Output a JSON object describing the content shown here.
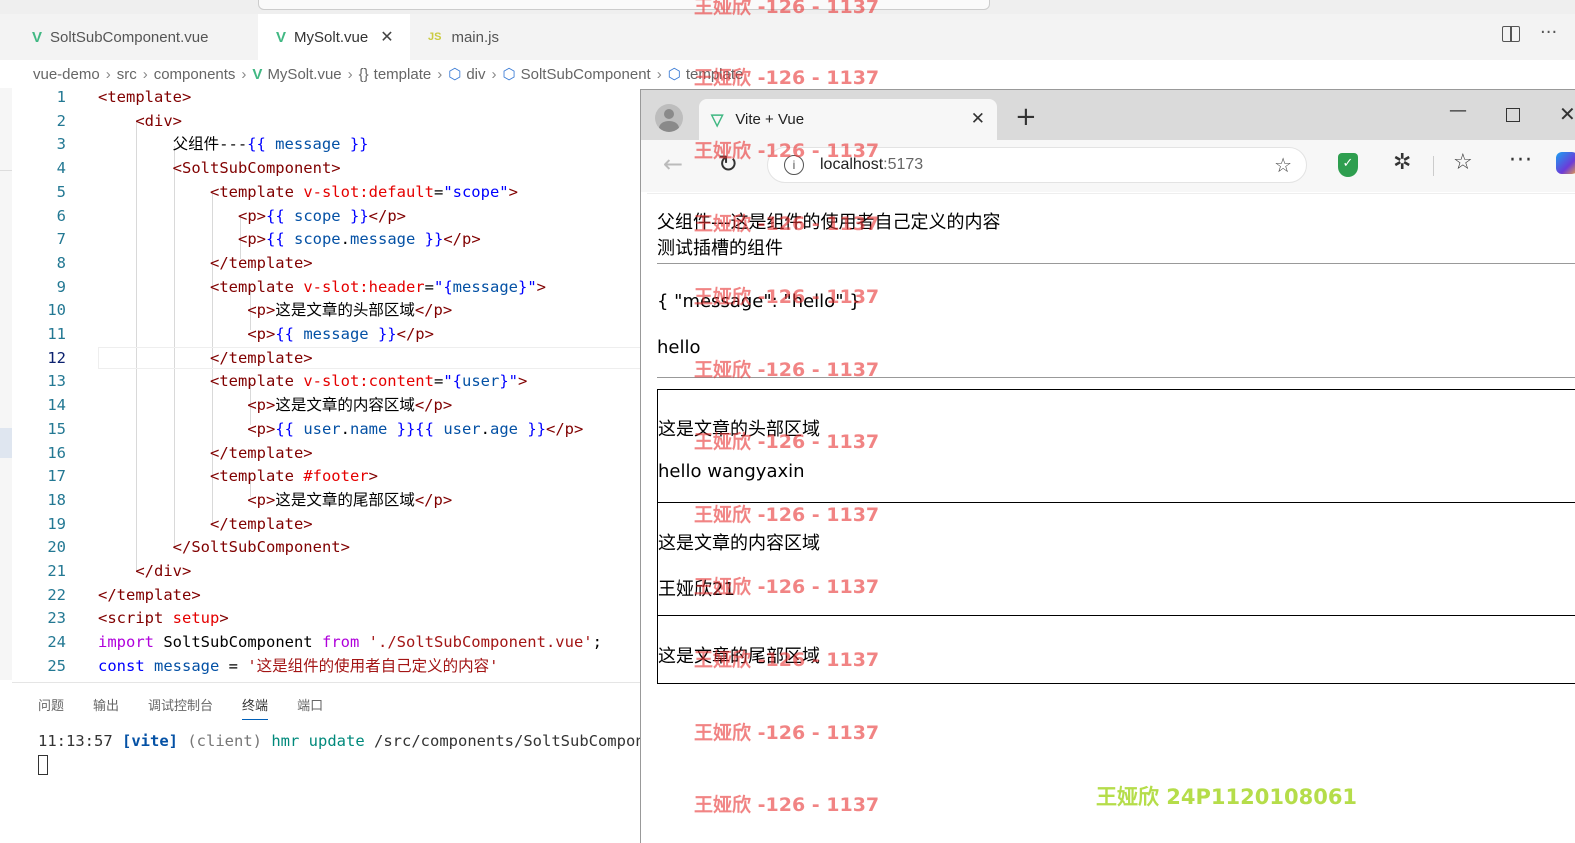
{
  "editor": {
    "tabs": [
      {
        "label": "SoltSubComponent.vue",
        "icon": "vue-icon",
        "active": false
      },
      {
        "label": "MySolt.vue",
        "icon": "vue-icon",
        "active": true
      },
      {
        "label": "main.js",
        "icon": "js-icon",
        "icon_text": "JS",
        "active": false
      }
    ],
    "breadcrumb": [
      "vue-demo",
      "src",
      "components",
      "MySolt.vue",
      "template",
      "div",
      "SoltSubComponent",
      "template"
    ],
    "breadcrumb_icons": {
      "template": "{}",
      "div": "⬡"
    },
    "current_line": 12,
    "line_numbers": [
      "1",
      "2",
      "3",
      "4",
      "5",
      "6",
      "7",
      "8",
      "9",
      "10",
      "11",
      "12",
      "13",
      "14",
      "15",
      "16",
      "17",
      "18",
      "19",
      "20",
      "21",
      "22",
      "23",
      "24",
      "25"
    ]
  },
  "panel": {
    "tabs": [
      "问题",
      "输出",
      "调试控制台",
      "终端",
      "端口"
    ],
    "active_tab": "终端",
    "terminal": {
      "time": "11:13:57",
      "tag": "[vite]",
      "client": "(client)",
      "action": "hmr update",
      "path": "/src/components/SoltSubComponent"
    }
  },
  "browser": {
    "tab_title": "Vite + Vue",
    "address_host": "localhost",
    "address_port": ":5173",
    "page": {
      "line1": "父组件---这是组件的使用者自己定义的内容",
      "line2": "测试插槽的组件",
      "scope": "{ \"message\": \"hello\" }",
      "message": "hello",
      "header_title": "这是文章的头部区域",
      "header_msg": "hello wangyaxin",
      "content_title": "这是文章的内容区域",
      "content_user": "王娅欣21",
      "footer_title": "这是文章的尾部区域"
    }
  },
  "watermark": "王娅欣 -126 - 1137",
  "signature": "王娅欣  24P1120108061",
  "colors": {
    "vue_green": "#41b883",
    "line_number": "#237893",
    "tag": "#800000",
    "attr": "#e50000",
    "keyword": "#af00db",
    "string": "#a31515"
  }
}
